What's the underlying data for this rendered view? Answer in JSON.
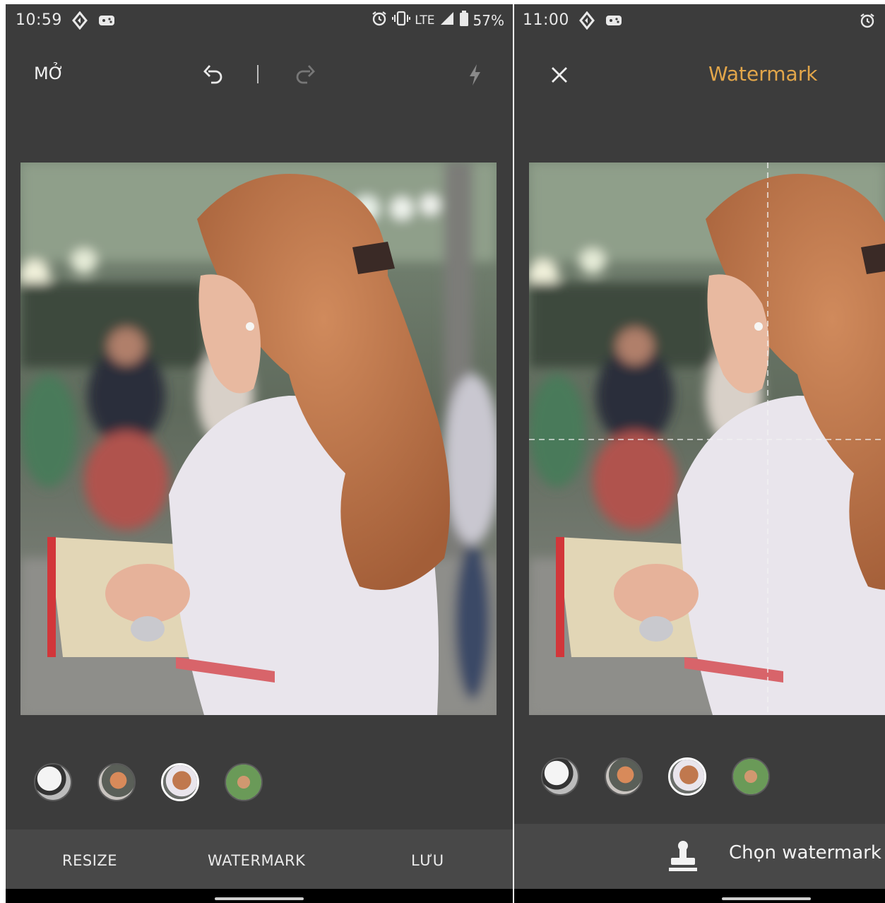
{
  "left_screen": {
    "status": {
      "time": "10:59",
      "network": "LTE",
      "battery": "57%"
    },
    "toolbar": {
      "open_label": "MỞ"
    },
    "thumbnails": [
      {
        "name": "photo-1",
        "active": false
      },
      {
        "name": "photo-2",
        "active": false
      },
      {
        "name": "photo-3",
        "active": true
      },
      {
        "name": "photo-4",
        "active": false
      }
    ],
    "bottom_tabs": {
      "resize": "RESIZE",
      "watermark": "WATERMARK",
      "save": "LƯU"
    }
  },
  "right_screen": {
    "status": {
      "time": "11:00"
    },
    "toolbar": {
      "title": "Watermark"
    },
    "thumbnails": [
      {
        "name": "photo-1",
        "active": false
      },
      {
        "name": "photo-2",
        "active": false
      },
      {
        "name": "photo-3",
        "active": true
      },
      {
        "name": "photo-4",
        "active": false
      }
    ],
    "bottom": {
      "choose_watermark": "Chọn watermark"
    }
  },
  "colors": {
    "background": "#3c3c3c",
    "bottom_bar": "#484848",
    "accent": "#e2a64a",
    "hair": "#c27a4e"
  },
  "icons": [
    "undo-icon",
    "redo-icon",
    "flash-icon",
    "close-icon",
    "stamp-icon",
    "alarm-icon",
    "vibrate-icon",
    "signal-icon",
    "battery-icon"
  ]
}
